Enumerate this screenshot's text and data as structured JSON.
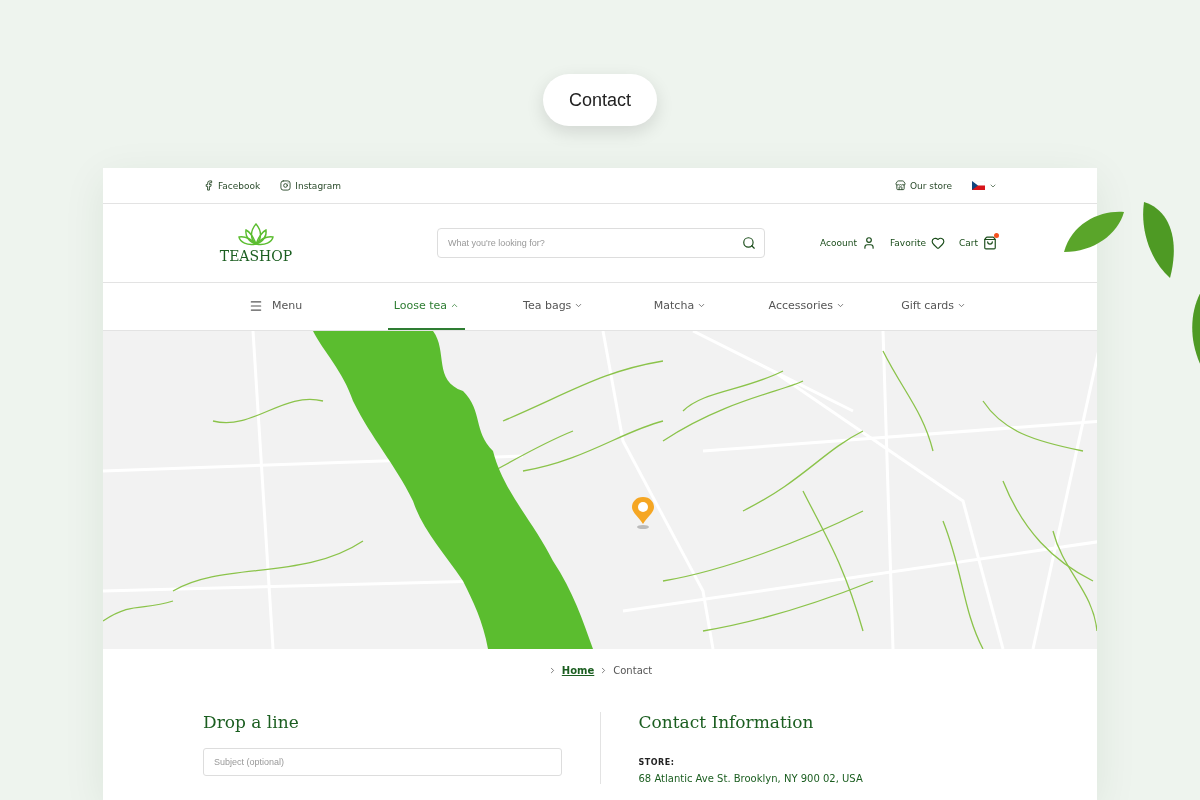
{
  "pill": {
    "label": "Contact"
  },
  "topbar": {
    "social": [
      {
        "label": "Facebook",
        "kind": "facebook"
      },
      {
        "label": "Instagram",
        "kind": "instagram"
      }
    ],
    "store": "Our store"
  },
  "header": {
    "logo": "TEASHOP",
    "search": {
      "placeholder": "What you're looking for?"
    },
    "actions": [
      {
        "label": "Acoount",
        "kind": "account",
        "notification": false
      },
      {
        "label": "Favorite",
        "kind": "favorite",
        "notification": false
      },
      {
        "label": "Cart",
        "kind": "cart",
        "notification": true
      }
    ]
  },
  "nav": {
    "menu": "Menu",
    "categories": [
      {
        "label": "Loose tea",
        "selected": true,
        "expanded": true
      },
      {
        "label": "Tea bags",
        "selected": false,
        "expanded": false
      },
      {
        "label": "Matcha",
        "selected": false,
        "expanded": false
      },
      {
        "label": "Accessories",
        "selected": false,
        "expanded": false
      },
      {
        "label": "Gift cards",
        "selected": false,
        "expanded": false
      }
    ]
  },
  "breadcrumb": [
    {
      "label": "Home",
      "kind": "link"
    },
    {
      "label": "Contact",
      "kind": "current"
    }
  ],
  "form": {
    "title": "Drop a line",
    "fields": [
      {
        "placeholder": "Subject (optional)"
      }
    ]
  },
  "contact": {
    "title": "Contact Information",
    "sections": [
      {
        "heading": "STORE:",
        "value": "68 Atlantic Ave St. Brooklyn, NY 900 02, USA"
      }
    ]
  }
}
